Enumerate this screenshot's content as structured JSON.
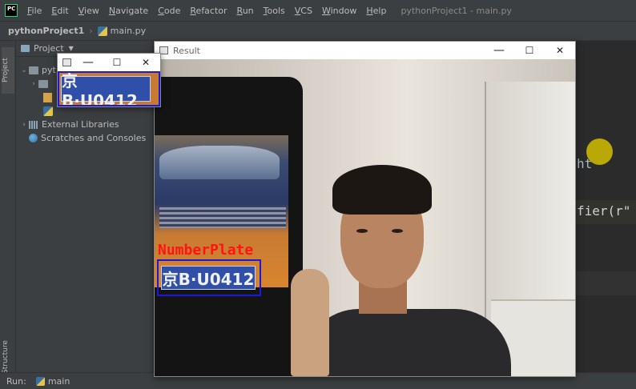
{
  "menubar": {
    "logo": "PC",
    "items": [
      "File",
      "Edit",
      "View",
      "Navigate",
      "Code",
      "Refactor",
      "Run",
      "Tools",
      "VCS",
      "Window",
      "Help"
    ],
    "window_title": "pythonProject1 - main.py"
  },
  "navbar": {
    "project": "pythonProject1",
    "file": "main.py"
  },
  "toolstrip": {
    "project_tab": "Project",
    "structure_tab": "Structure"
  },
  "project_panel": {
    "header": "Project",
    "root_partial": "pyt",
    "rows": [
      {
        "label": "External Libraries"
      },
      {
        "label": "Scratches and Consoles"
      }
    ]
  },
  "editor": {
    "fragment_1": "ht",
    "fragment_2": "fier(r\""
  },
  "bottom": {
    "run_label": "Run:",
    "run_tab": "main"
  },
  "result_window": {
    "title": "Result",
    "minimize": "—",
    "maximize": "☐",
    "close": "✕",
    "label": "NumberPlate",
    "plate_text": "京B·U0412"
  },
  "crop_window": {
    "minimize": "—",
    "maximize": "☐",
    "close": "✕",
    "plate_text": "京B·U0412"
  },
  "colors": {
    "ide_bg": "#2b2b2b",
    "panel_bg": "#3c3f41",
    "detection_box": "#1a1adc",
    "label_red": "#ff1414",
    "plate_blue": "#2f4fa8"
  }
}
